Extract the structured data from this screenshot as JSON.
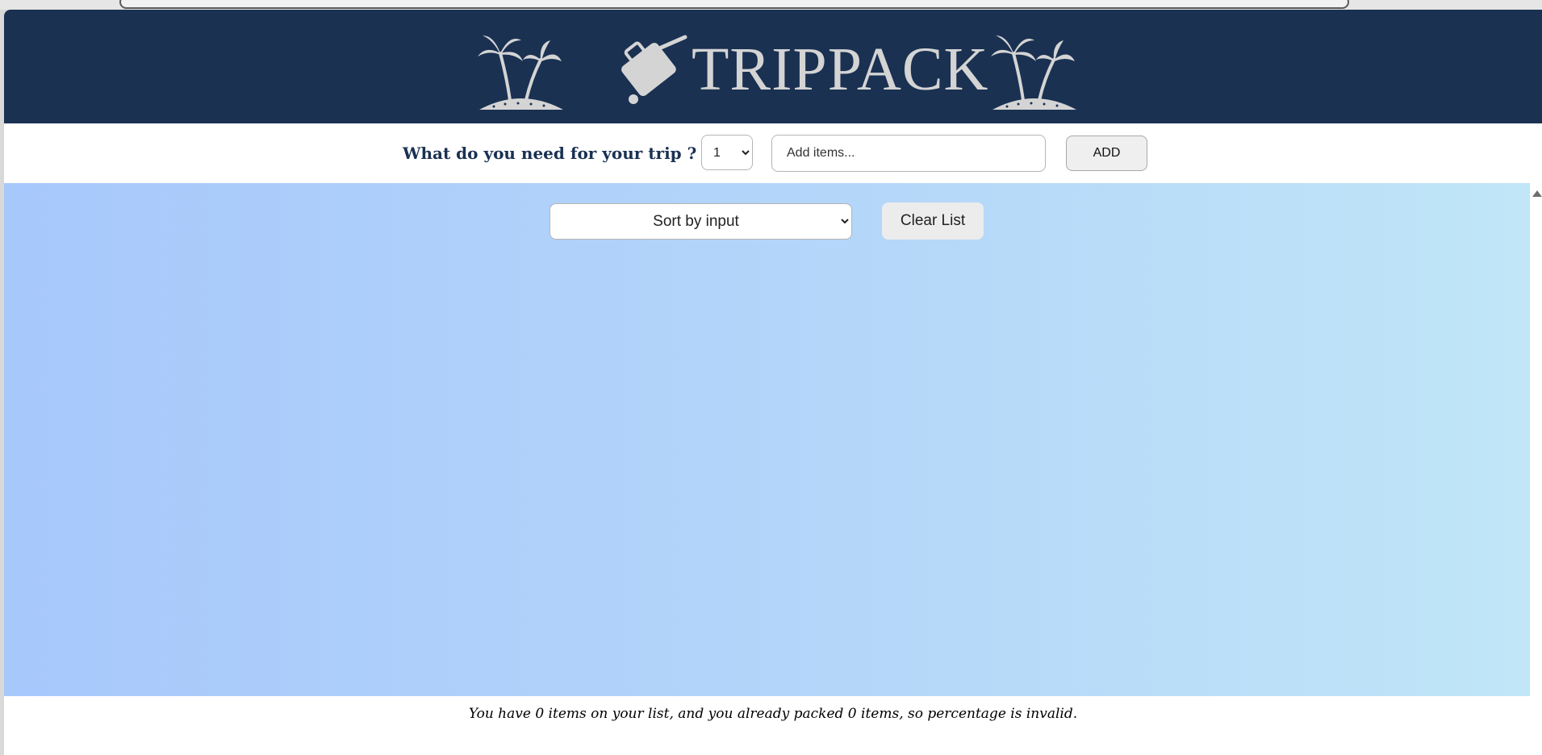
{
  "header": {
    "logo_text": "TRIPPACK",
    "colors": {
      "background": "#1a3152",
      "logo": "#d4d4d4"
    },
    "icons": [
      "palm-tree-icon",
      "luggage-icon",
      "palm-tree-icon"
    ]
  },
  "form": {
    "question": "What do you need for your trip ?",
    "quantity_selected": "1",
    "input_placeholder": "Add items...",
    "add_label": "ADD"
  },
  "list": {
    "sort_selected": "Sort by input",
    "clear_label": "Clear List",
    "items": []
  },
  "stats": {
    "text": "You have 0 items on your list, and you already packed 0 items, so percentage is invalid."
  }
}
